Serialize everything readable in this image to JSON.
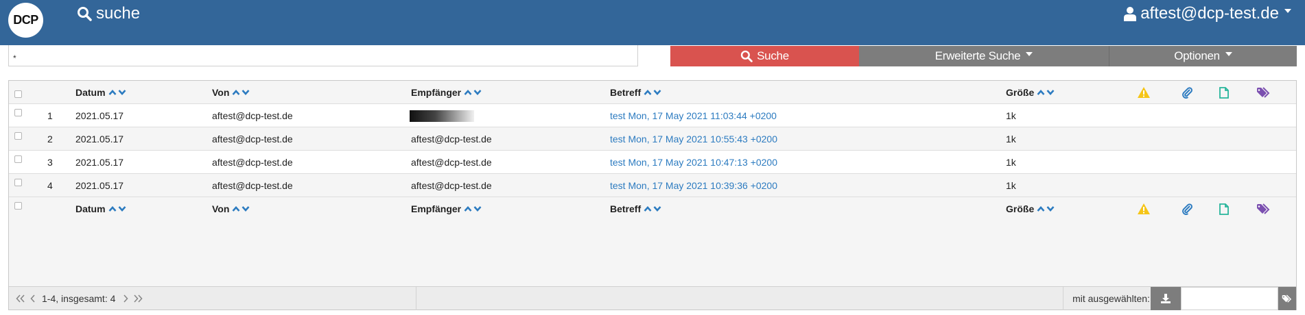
{
  "header": {
    "logo_text": "DCP",
    "search_link": "suche",
    "user_email": "aftest@dcp-test.de"
  },
  "search": {
    "query": "*",
    "search_button": "Suche",
    "advanced_button": "Erweiterte Suche",
    "options_button": "Optionen"
  },
  "table": {
    "columns": {
      "date": "Datum",
      "from": "Von",
      "to": "Empfänger",
      "subject": "Betreff",
      "size": "Größe"
    },
    "rows": [
      {
        "num": "1",
        "date": "2021.05.17",
        "from": "aftest@dcp-test.de",
        "to": "",
        "subject": "test Mon, 17 May 2021 11:03:44 +0200",
        "size": "1k"
      },
      {
        "num": "2",
        "date": "2021.05.17",
        "from": "aftest@dcp-test.de",
        "to": "aftest@dcp-test.de",
        "subject": "test Mon, 17 May 2021 10:55:43 +0200",
        "size": "1k"
      },
      {
        "num": "3",
        "date": "2021.05.17",
        "from": "aftest@dcp-test.de",
        "to": "aftest@dcp-test.de",
        "subject": "test Mon, 17 May 2021 10:47:13 +0200",
        "size": "1k"
      },
      {
        "num": "4",
        "date": "2021.05.17",
        "from": "aftest@dcp-test.de",
        "to": "aftest@dcp-test.de",
        "subject": "test Mon, 17 May 2021 10:39:36 +0200",
        "size": "1k"
      }
    ]
  },
  "footer": {
    "pager_text": "1-4, insgesamt: 4",
    "bulk_label": "mit ausgewählten:"
  },
  "colors": {
    "topbar": "#336699",
    "search_button": "#d9534f",
    "grey_button": "#7d7d7d",
    "link": "#2c7bc0",
    "warning_icon": "#f5c518",
    "attachment_icon": "#2c7bc0",
    "file_icon": "#27b59b",
    "tags_icon": "#7b4fb0"
  }
}
